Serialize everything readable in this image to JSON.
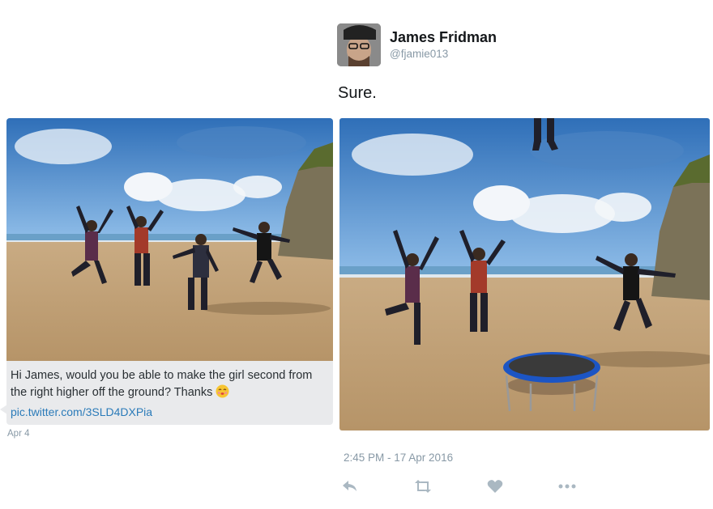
{
  "request": {
    "message": "Hi James, would you be able to make the girl second from the right higher off the ground? Thanks",
    "emoji_icon": "kiss-face-emoji",
    "link": "pic.twitter.com/3SLD4DXPia",
    "date": "Apr 4"
  },
  "tweet": {
    "author_name": "James Fridman",
    "author_handle": "@fjamie013",
    "text": "Sure.",
    "timestamp": "2:45 PM - 17 Apr 2016"
  },
  "actions": [
    {
      "name": "reply",
      "icon": "reply-arrow-icon"
    },
    {
      "name": "retweet",
      "icon": "retweet-icon"
    },
    {
      "name": "like",
      "icon": "heart-icon"
    },
    {
      "name": "more",
      "icon": "ellipsis-icon"
    }
  ],
  "colors": {
    "text_primary": "#14171a",
    "text_secondary": "#8899a6",
    "link": "#2b7bb9",
    "card_background": "#e9eaec",
    "action_icon": "#aab8c2"
  }
}
